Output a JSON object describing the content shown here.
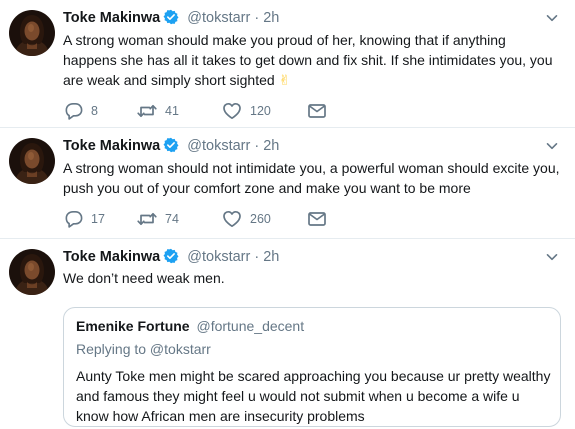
{
  "tweets": [
    {
      "author": "Toke Makinwa",
      "handle": "@tokstarr",
      "separator": "·",
      "time": "2h",
      "text": "A strong woman should make you proud of her, knowing that if anything happens she has all it takes to get down and fix shit. If she intimidates you, you are weak and simply short sighted",
      "emoji": "✌",
      "replies": "8",
      "retweets": "41",
      "likes": "120"
    },
    {
      "author": "Toke Makinwa",
      "handle": "@tokstarr",
      "separator": "·",
      "time": "2h",
      "text": "A strong woman should not intimidate you, a powerful woman should excite you, push you out of your comfort zone and make you want to be more",
      "replies": "17",
      "retweets": "74",
      "likes": "260"
    },
    {
      "author": "Toke Makinwa",
      "handle": "@tokstarr",
      "separator": "·",
      "time": "2h",
      "text": "We don’t need weak men.",
      "quote": {
        "author": "Emenike Fortune",
        "handle": "@fortune_decent",
        "replying_to": "Replying to @tokstarr",
        "text": "Aunty Toke men might be scared approaching you because ur pretty wealthy and famous they might feel u would not submit when u become a wife u know how African men are insecurity problems"
      }
    }
  ],
  "icons": [
    "verified-badge-icon",
    "chevron-down-icon",
    "reply-icon",
    "retweet-icon",
    "like-icon",
    "direct-message-icon"
  ],
  "colors": {
    "text": "#14171a",
    "secondary": "#657786",
    "verified": "#1da1f2",
    "divider": "#e6ecf0",
    "emoji": "#ffcc33"
  }
}
